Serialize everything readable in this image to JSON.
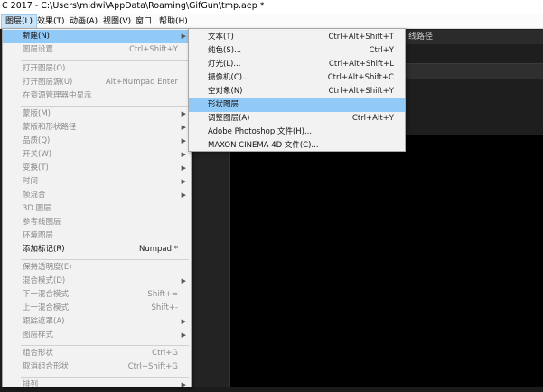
{
  "window": {
    "title": "C 2017 - C:\\Users\\midwi\\AppData\\Roaming\\GifGun\\tmp.aep *"
  },
  "menubar": [
    {
      "label": "图层(L)",
      "active": true
    },
    {
      "label": "效果(T)"
    },
    {
      "label": "动画(A)"
    },
    {
      "label": "视图(V)"
    },
    {
      "label": "窗口"
    },
    {
      "label": "帮助(H)"
    }
  ],
  "panel": {
    "header_text": "线路径"
  },
  "layer_menu": [
    {
      "label": "新建(N)",
      "shortcut": "",
      "submenu": true,
      "highlight": true
    },
    {
      "label": "图层设置...",
      "shortcut": "Ctrl+Shift+Y",
      "disabled": true
    },
    {
      "sep": true
    },
    {
      "label": "打开图层(O)",
      "shortcut": "",
      "disabled": true
    },
    {
      "label": "打开图层源(U)",
      "shortcut": "Alt+Numpad Enter",
      "disabled": true
    },
    {
      "label": "在资源管理器中显示",
      "shortcut": "",
      "disabled": true
    },
    {
      "sep": true
    },
    {
      "label": "蒙版(M)",
      "submenu": true,
      "disabled": true
    },
    {
      "label": "蒙版和形状路径",
      "submenu": true,
      "disabled": true
    },
    {
      "label": "品质(Q)",
      "submenu": true,
      "disabled": true
    },
    {
      "label": "开关(W)",
      "submenu": true,
      "disabled": true
    },
    {
      "label": "变换(T)",
      "submenu": true,
      "disabled": true
    },
    {
      "label": "时间",
      "submenu": true,
      "disabled": true
    },
    {
      "label": "帧混合",
      "submenu": true,
      "disabled": true
    },
    {
      "label": "3D 图层",
      "disabled": true
    },
    {
      "label": "参考线图层",
      "disabled": true
    },
    {
      "label": "环境图层",
      "disabled": true
    },
    {
      "label": "添加标记(R)",
      "shortcut": "Numpad *"
    },
    {
      "sep": true
    },
    {
      "label": "保持透明度(E)",
      "disabled": true
    },
    {
      "label": "混合模式(D)",
      "submenu": true,
      "disabled": true
    },
    {
      "label": "下一混合模式",
      "shortcut": "Shift+=",
      "disabled": true
    },
    {
      "label": "上一混合模式",
      "shortcut": "Shift+-",
      "disabled": true
    },
    {
      "label": "跟踪遮罩(A)",
      "submenu": true,
      "disabled": true
    },
    {
      "label": "图层样式",
      "submenu": true,
      "disabled": true
    },
    {
      "sep": true
    },
    {
      "label": "组合形状",
      "shortcut": "Ctrl+G",
      "disabled": true
    },
    {
      "label": "取消组合形状",
      "shortcut": "Ctrl+Shift+G",
      "disabled": true
    },
    {
      "sep": true
    },
    {
      "label": "排列",
      "submenu": true,
      "disabled": true
    }
  ],
  "new_submenu": [
    {
      "label": "文本(T)",
      "shortcut": "Ctrl+Alt+Shift+T"
    },
    {
      "label": "纯色(S)...",
      "shortcut": "Ctrl+Y"
    },
    {
      "label": "灯光(L)...",
      "shortcut": "Ctrl+Alt+Shift+L"
    },
    {
      "label": "摄像机(C)...",
      "shortcut": "Ctrl+Alt+Shift+C"
    },
    {
      "label": "空对象(N)",
      "shortcut": "Ctrl+Alt+Shift+Y"
    },
    {
      "label": "形状图层",
      "shortcut": "",
      "highlight": true
    },
    {
      "label": "调整图层(A)",
      "shortcut": "Ctrl+Alt+Y"
    },
    {
      "label": "Adobe Photoshop 文件(H)...",
      "shortcut": ""
    },
    {
      "label": "MAXON CINEMA 4D 文件(C)...",
      "shortcut": ""
    }
  ]
}
